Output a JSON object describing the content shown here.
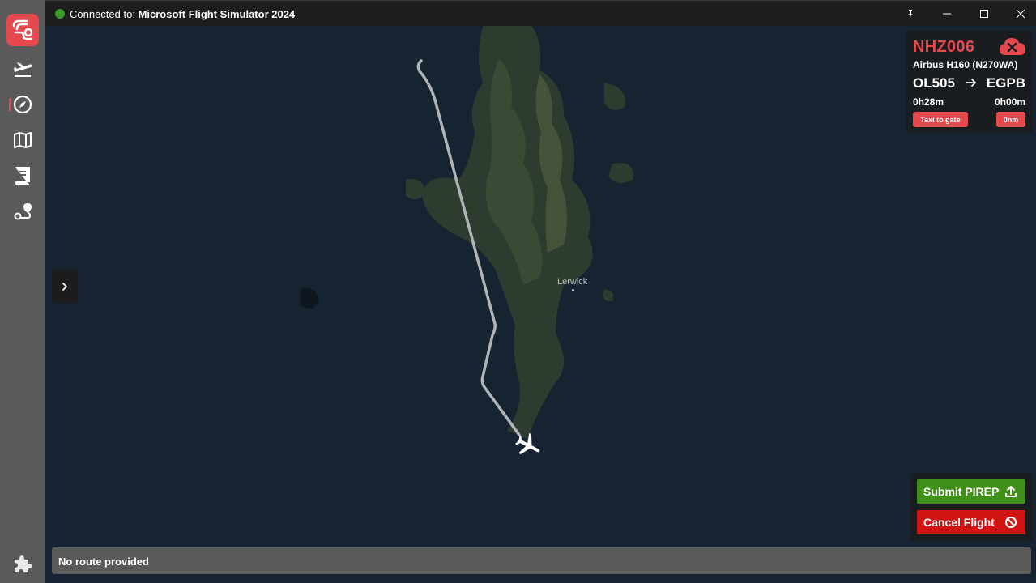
{
  "titlebar": {
    "connected_prefix": "Connected to:",
    "simulator": "Microsoft Flight Simulator 2024",
    "status_color": "#3a9a2a"
  },
  "sidebar": {
    "items": [
      {
        "name": "flights",
        "icon": "plane-departure-icon"
      },
      {
        "name": "navigation",
        "icon": "compass-icon",
        "active": true
      },
      {
        "name": "map",
        "icon": "map-icon"
      },
      {
        "name": "logbook",
        "icon": "book-icon"
      },
      {
        "name": "route",
        "icon": "route-icon"
      }
    ],
    "bottom_icon": "puzzle-icon"
  },
  "map": {
    "town": "Lerwick"
  },
  "flight": {
    "callsign": "NHZ006",
    "aircraft": "Airbus H160 (N270WA)",
    "departure": "OL505",
    "arrival": "EGPB",
    "elapsed": "0h28m",
    "remaining": "0h00m",
    "phase": "Taxi to gate",
    "distance": "0nm"
  },
  "actions": {
    "submit_label": "Submit PIREP",
    "cancel_label": "Cancel Flight"
  },
  "route": {
    "text": "No route provided"
  },
  "colors": {
    "accent": "#e5484d",
    "submit": "#3f8f19",
    "cancel": "#d01414"
  }
}
